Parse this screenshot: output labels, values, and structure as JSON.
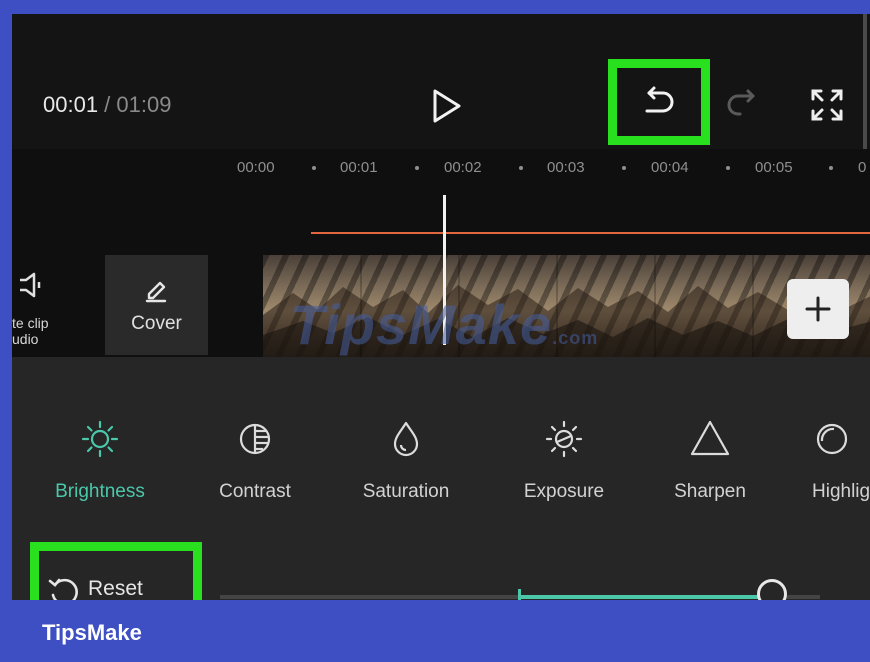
{
  "player": {
    "current_time": "00:01",
    "separator": " / ",
    "total_time": "01:09"
  },
  "ruler": {
    "ticks": [
      "00:00",
      "00:01",
      "00:02",
      "00:03",
      "00:04",
      "00:05",
      "0"
    ]
  },
  "timeline": {
    "mute_label": "te clip\nudio",
    "cover_label": "Cover"
  },
  "adjust_tools": {
    "items": [
      {
        "label": "Brightness",
        "icon": "sun-icon",
        "active": true
      },
      {
        "label": "Contrast",
        "icon": "contrast-icon"
      },
      {
        "label": "Saturation",
        "icon": "drop-icon"
      },
      {
        "label": "Exposure",
        "icon": "exposure-icon"
      },
      {
        "label": "Sharpen",
        "icon": "triangle-icon"
      },
      {
        "label": "Highlig",
        "icon": "highlight-icon"
      }
    ],
    "reset_label": "Reset",
    "slider_value_fraction": 0.92
  },
  "watermark": {
    "text": "TipsMake",
    "suffix": ".com"
  },
  "footer": {
    "brand": "TipsMake"
  },
  "colors": {
    "accent": "#4bc7a9",
    "highlight_box": "#29e01e",
    "playhead_line": "#e2673e",
    "frame_border": "#3d4fc2"
  }
}
